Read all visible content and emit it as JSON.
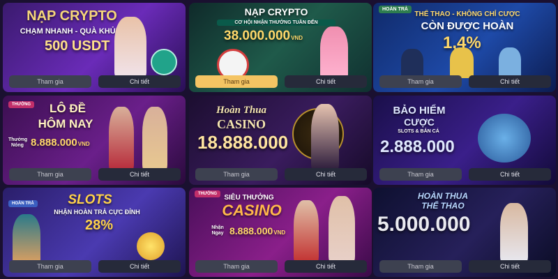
{
  "buttons": {
    "join": "Tham gia",
    "detail": "Chi tiết"
  },
  "cards": [
    {
      "title": "NẠP CRYPTO",
      "subtitle": "CHẠM NHANH - QUÀ KHỦNG",
      "amount": "500 USDT"
    },
    {
      "title": "NẠP CRYPTO",
      "subtitle": "CƠ HỘI NHẬN THƯỞNG TUẦN ĐẾN",
      "amount": "38.000.000",
      "unit": "VND"
    },
    {
      "tag": "HOÀN TRẢ",
      "title_line1": "THỂ THAO - KHÔNG CHỈ CƯỢC",
      "title_line2": "CÒN ĐƯỢC HOÀN",
      "amount": "1,4%"
    },
    {
      "tag": "THƯỞNG",
      "title_line1": "LÔ ĐỀ",
      "title_line2": "HÔM NAY",
      "label": "Thưởng Nóng",
      "amount": "8.888.000",
      "unit": "VND"
    },
    {
      "title_line1": "Hoàn Thua",
      "title_line2": "CASINO",
      "amount": "18.888.000"
    },
    {
      "title_line1": "BẢO HIỂM",
      "title_line2": "CƯỢC",
      "subtitle": "SLOTS & BẮN CÁ",
      "amount": "2.888.000"
    },
    {
      "tag": "HOÀN TRẢ",
      "title": "SLOTS",
      "subtitle": "NHẬN HOÀN TRẢ CỰC ĐỈNH",
      "amount": "28%"
    },
    {
      "tag": "THƯỞNG",
      "title_line1": "SIÊU THƯỞNG",
      "title_line2": "CASINO",
      "label": "Nhận Ngay",
      "amount": "8.888.000",
      "unit": "VND"
    },
    {
      "title_line1": "HOÀN THUA",
      "title_line2": "THỂ THAO",
      "amount": "5.000.000"
    }
  ]
}
